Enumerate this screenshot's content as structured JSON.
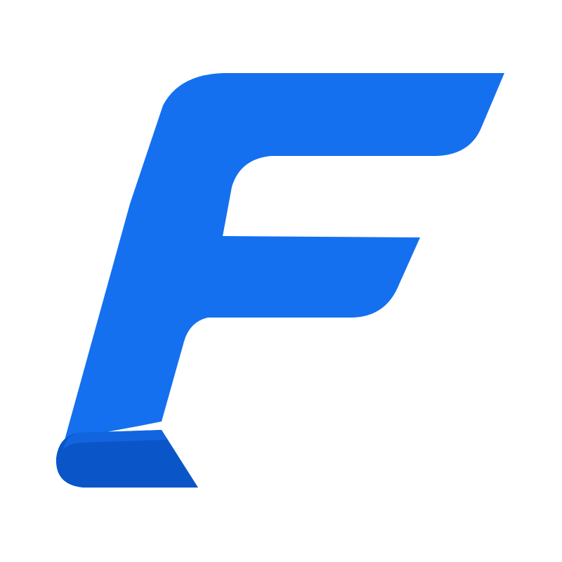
{
  "logo": {
    "icon": "letter-f-logo-icon",
    "colors": {
      "primary": "#1570ef",
      "fold_shadow": "#0a56c8",
      "background": "#ffffff"
    }
  }
}
